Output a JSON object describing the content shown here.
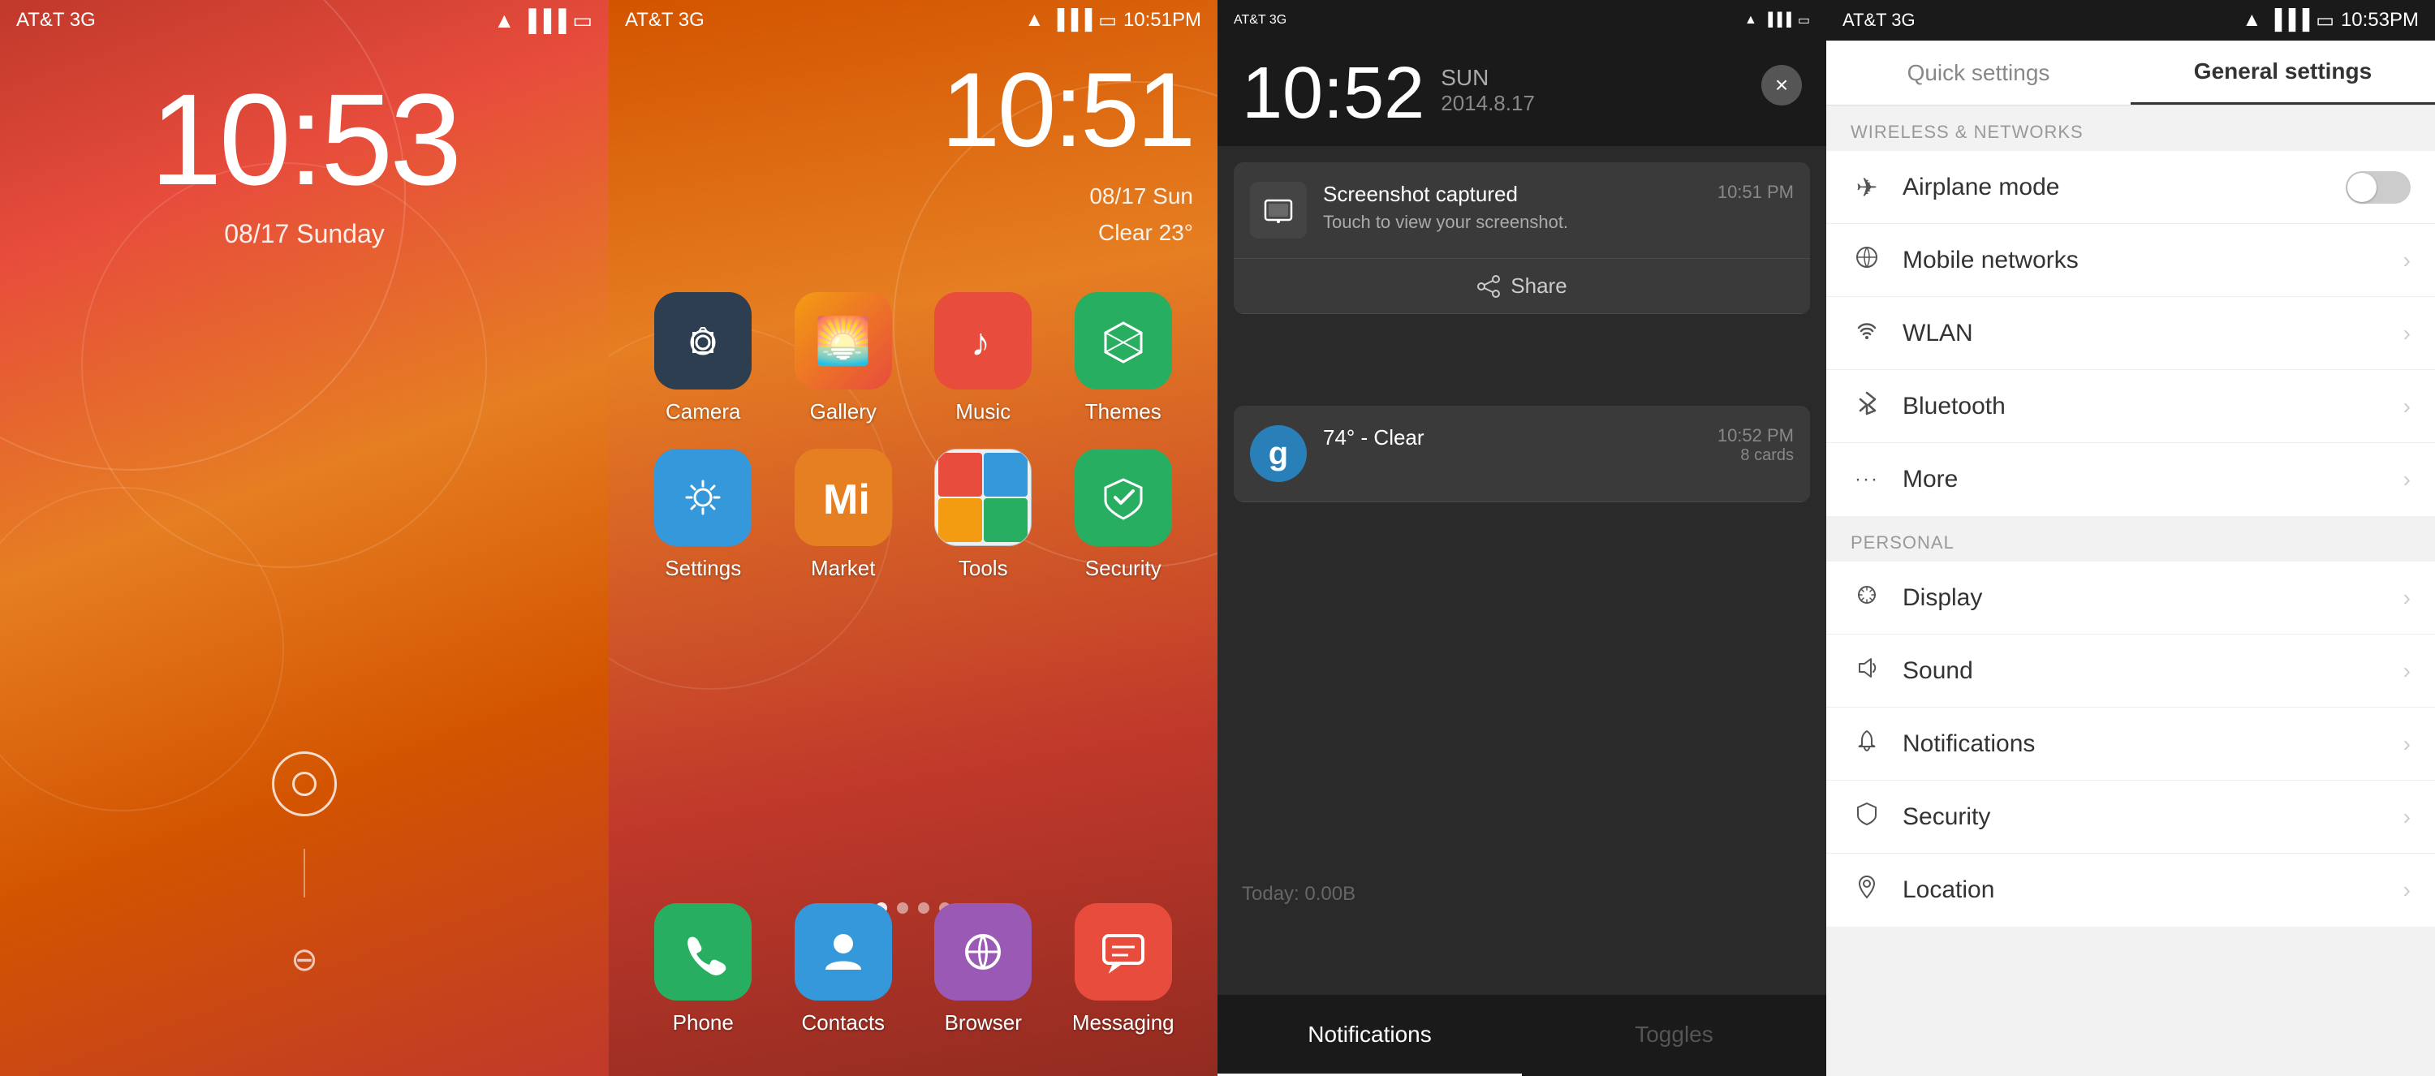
{
  "screen1": {
    "carrier": "AT&T 3G",
    "time": "10:53",
    "date": "08/17 Sunday",
    "status_icons": [
      "wifi",
      "signal",
      "battery"
    ]
  },
  "screen2": {
    "carrier": "AT&T 3G",
    "time": "10:51",
    "date_line1": "08/17 Sun",
    "date_line2": "Clear  23°",
    "status_icons": [
      "wifi",
      "signal",
      "battery"
    ],
    "battery_text": "10:51PM",
    "apps_row1": [
      {
        "label": "Camera",
        "icon_type": "camera"
      },
      {
        "label": "Gallery",
        "icon_type": "gallery"
      },
      {
        "label": "Music",
        "icon_type": "music"
      },
      {
        "label": "Themes",
        "icon_type": "themes"
      }
    ],
    "apps_row2": [
      {
        "label": "Settings",
        "icon_type": "settings"
      },
      {
        "label": "Market",
        "icon_type": "market"
      },
      {
        "label": "Tools",
        "icon_type": "tools"
      },
      {
        "label": "Security",
        "icon_type": "security"
      }
    ],
    "dock_apps": [
      {
        "label": "Phone",
        "icon_type": "phone"
      },
      {
        "label": "Contacts",
        "icon_type": "contacts"
      },
      {
        "label": "Browser",
        "icon_type": "browser"
      },
      {
        "label": "Messaging",
        "icon_type": "messaging"
      }
    ]
  },
  "screen3": {
    "carrier": "AT&T 3G",
    "time": "10:52",
    "day": "SUN",
    "full_date": "2014.8.17",
    "close_btn": "×",
    "notifications": [
      {
        "title": "Screenshot captured",
        "desc": "Touch to view your screenshot.",
        "time": "10:51 PM",
        "icon": "📷"
      }
    ],
    "share_label": "Share",
    "notification2_title": "74° - Clear",
    "notification2_time": "10:52 PM",
    "notification2_sub": "8 cards",
    "data_usage": "Today: 0.00B",
    "tab_notifications": "Notifications",
    "tab_toggles": "Toggles"
  },
  "screen4": {
    "carrier": "AT&T 3G",
    "time": "10:53PM",
    "tab_quick": "Quick settings",
    "tab_general": "General settings",
    "section_wireless": "WIRELESS & NETWORKS",
    "section_personal": "PERSONAL",
    "items_wireless": [
      {
        "label": "Airplane mode",
        "icon": "✈",
        "has_toggle": true
      },
      {
        "label": "Mobile networks",
        "icon": "⊕",
        "has_arrow": true
      },
      {
        "label": "WLAN",
        "icon": "📶",
        "has_arrow": true
      },
      {
        "label": "Bluetooth",
        "icon": "✱",
        "has_arrow": true
      },
      {
        "label": "More",
        "icon": "···",
        "has_arrow": true
      }
    ],
    "items_personal": [
      {
        "label": "Display",
        "icon": "⚙",
        "has_arrow": true
      },
      {
        "label": "Sound",
        "icon": "🔊",
        "has_arrow": true
      },
      {
        "label": "Notifications",
        "icon": "🔔",
        "has_arrow": true
      },
      {
        "label": "Security",
        "icon": "🛡",
        "has_arrow": true
      },
      {
        "label": "Location",
        "icon": "📍",
        "has_arrow": true
      }
    ]
  }
}
